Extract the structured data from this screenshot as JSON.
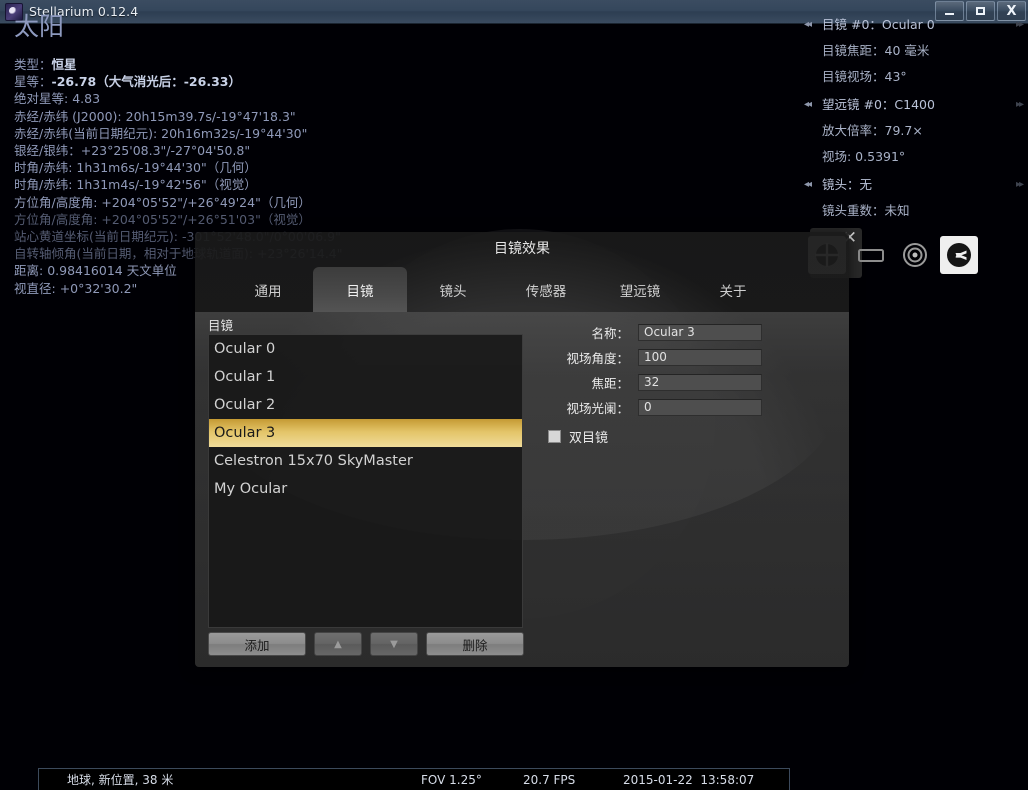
{
  "window": {
    "title": "Stellarium 0.12.4",
    "app_icon": "stellarium-icon",
    "minimize_label": "–",
    "maximize_label": "□",
    "close_label": "X"
  },
  "info_panel": {
    "object_name": "太阳",
    "rows": [
      {
        "label": "类型：",
        "value": "恒星",
        "bold": true
      },
      {
        "label": "星等：",
        "value": "-26.78（大气消光后：-26.33）",
        "bold": true
      },
      {
        "label": "绝对星等: ",
        "value": "4.83",
        "bold": false
      },
      {
        "label": "赤经/赤纬 (J2000): ",
        "value": "20h15m39.7s/-19°47'18.3\"",
        "bold": false
      },
      {
        "label": "赤经/赤纬(当前日期纪元): ",
        "value": "20h16m32s/-19°44'30\"",
        "bold": false
      },
      {
        "label": "银经/银纬：",
        "value": "+23°25'08.3\"/-27°04'50.8\"",
        "bold": false
      },
      {
        "label": "时角/赤纬: ",
        "value": "1h31m6s/-19°44'30\"（几何）",
        "bold": false
      },
      {
        "label": "时角/赤纬: ",
        "value": "1h31m4s/-19°42'56\"（视觉）",
        "bold": false
      },
      {
        "label": "方位角/高度角: ",
        "value": "+204°05'52\"/+26°49'24\"（几何）",
        "bold": false
      },
      {
        "label": "方位角/高度角: ",
        "value": "+204°05'52\"/+26°51'03\"（视觉）",
        "bold": false,
        "dim": true
      },
      {
        "label": "站心黄道坐标(当前日期纪元): ",
        "value": "-301°52'48.0\"/0°00'06.9\"",
        "bold": false,
        "dim": true
      },
      {
        "label": "自转轴倾角(当前日期，相对于地球轨道面): ",
        "value": "+23°26'14.4\"",
        "bold": false,
        "dim": true
      },
      {
        "label": "距离: ",
        "value": "0.98416014 天文单位",
        "bold": false
      },
      {
        "label": "视直径: ",
        "value": "+0°32'30.2\"",
        "bold": false
      }
    ]
  },
  "ocular_panel": {
    "arrow_left": "◂◂",
    "arrow_right": "▸▸",
    "groups": [
      {
        "head": "目镜 #0：Ocular 0",
        "subs": [
          "目镜焦距：40 毫米",
          "目镜视场：43°"
        ]
      },
      {
        "head": "望远镜 #0：C1400",
        "subs": [
          "放大倍率：79.7×",
          "视场: 0.5391°"
        ]
      },
      {
        "head": "镜头：无",
        "subs": [
          "镜头重数：未知"
        ]
      }
    ]
  },
  "ocular_toolbar": {
    "close_label": "✕",
    "buttons": [
      {
        "icon": "crosshair-icon",
        "selected": true
      },
      {
        "icon": "sensor-rectangle-icon",
        "selected": false
      },
      {
        "icon": "telrad-icon",
        "selected": false
      },
      {
        "icon": "wrench-settings-icon",
        "selected": true
      }
    ]
  },
  "dialog": {
    "title": "目镜效果",
    "tabs": [
      {
        "label": "通用",
        "active": false
      },
      {
        "label": "目镜",
        "active": true
      },
      {
        "label": "镜头",
        "active": false
      },
      {
        "label": "传感器",
        "active": false
      },
      {
        "label": "望远镜",
        "active": false
      },
      {
        "label": "关于",
        "active": false
      }
    ],
    "group_label": "目镜",
    "list_items": [
      {
        "label": "Ocular 0",
        "selected": false
      },
      {
        "label": "Ocular 1",
        "selected": false
      },
      {
        "label": "Ocular 2",
        "selected": false
      },
      {
        "label": "Ocular 3",
        "selected": true
      },
      {
        "label": "Celestron 15x70 SkyMaster",
        "selected": false
      },
      {
        "label": "My Ocular",
        "selected": false
      }
    ],
    "fields": [
      {
        "label": "名称：",
        "value": "Ocular 3"
      },
      {
        "label": "视场角度：",
        "value": "100"
      },
      {
        "label": "焦距：",
        "value": "32"
      },
      {
        "label": "视场光阑：",
        "value": "0"
      }
    ],
    "checkbox": {
      "label": "双目镜",
      "checked": false
    },
    "buttons": {
      "add": "添加",
      "up": "▲",
      "down": "▼",
      "delete": "删除"
    }
  },
  "statusbar": {
    "location": "地球, 新位置, 38 米",
    "fov": "FOV 1.25°",
    "fps": "20.7 FPS",
    "date": "2015-01-22",
    "time": "13:58:07"
  },
  "colors": {
    "selection_gold": "#e3c468",
    "info_text": "#8f99b8",
    "titlebar": "#35475c"
  }
}
